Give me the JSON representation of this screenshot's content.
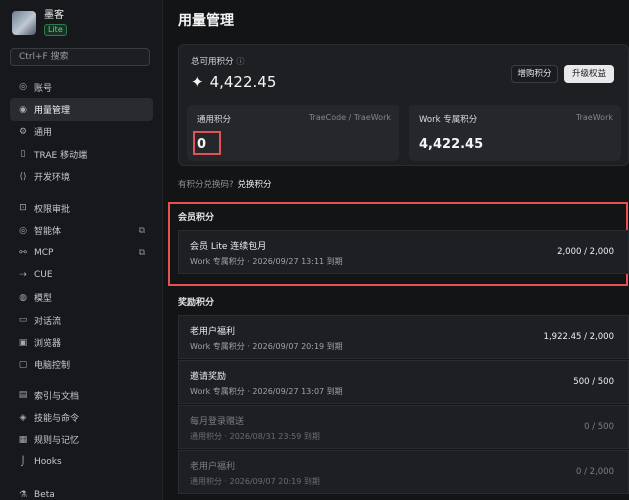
{
  "sidebar": {
    "profile_name": "墨客",
    "plan_badge": "Lite",
    "search_placeholder": "Ctrl+F 搜索",
    "group1": [
      {
        "label": "账号",
        "icon": "user-icon"
      },
      {
        "label": "用量管理",
        "icon": "usage-icon",
        "active": true
      },
      {
        "label": "通用",
        "icon": "gear-icon"
      },
      {
        "label": "TRAE 移动端",
        "icon": "mobile-icon"
      },
      {
        "label": "开发环境",
        "icon": "code-icon"
      }
    ],
    "group2": [
      {
        "label": "权限审批",
        "icon": "lock-icon"
      },
      {
        "label": "智能体",
        "icon": "agent-icon",
        "external": true
      },
      {
        "label": "MCP",
        "icon": "mcp-icon",
        "external": true
      },
      {
        "label": "CUE",
        "icon": "cue-icon"
      },
      {
        "label": "模型",
        "icon": "model-icon"
      },
      {
        "label": "对话流",
        "icon": "chat-icon"
      },
      {
        "label": "浏览器",
        "icon": "browser-icon"
      },
      {
        "label": "电脑控制",
        "icon": "monitor-icon"
      }
    ],
    "group3": [
      {
        "label": "索引与文档",
        "icon": "index-icon"
      },
      {
        "label": "技能与命令",
        "icon": "skill-icon"
      },
      {
        "label": "规则与记忆",
        "icon": "rules-icon"
      },
      {
        "label": "Hooks",
        "icon": "hook-icon"
      }
    ],
    "group4": [
      {
        "label": "Beta",
        "icon": "beta-icon"
      }
    ]
  },
  "main": {
    "title": "用量管理",
    "total_label": "总可用积分",
    "total_value": "4,422.45",
    "buy_button": "增购积分",
    "upgrade_button": "升级权益",
    "general": {
      "label": "通用积分",
      "tag": "TraeCode / TraeWork",
      "value": "0"
    },
    "work": {
      "label": "Work 专属积分",
      "tag": "TraeWork",
      "value": "4,422.45"
    },
    "redeem_question": "有积分兑换码?",
    "redeem_link": "兑换积分",
    "member_section": "会员积分",
    "member_rows": [
      {
        "title": "会员 Lite 连续包月",
        "sub": "Work 专属积分 · 2026/09/27 13:11 到期",
        "value": "2,000 / 2,000"
      }
    ],
    "reward_section": "奖励积分",
    "reward_rows": [
      {
        "title": "老用户福利",
        "sub": "Work 专属积分 · 2026/09/07 20:19 到期",
        "value": "1,922.45 / 2,000",
        "dim": false
      },
      {
        "title": "邀请奖励",
        "sub": "Work 专属积分 · 2026/09/27 13:07 到期",
        "value": "500 / 500",
        "dim": false
      },
      {
        "title": "每月登录赠送",
        "sub": "通用积分 · 2026/08/31 23:59 到期",
        "value": "0 / 500",
        "dim": true
      },
      {
        "title": "老用户福利",
        "sub": "通用积分 · 2026/09/07 20:19 到期",
        "value": "0 / 2,000",
        "dim": true
      }
    ]
  }
}
